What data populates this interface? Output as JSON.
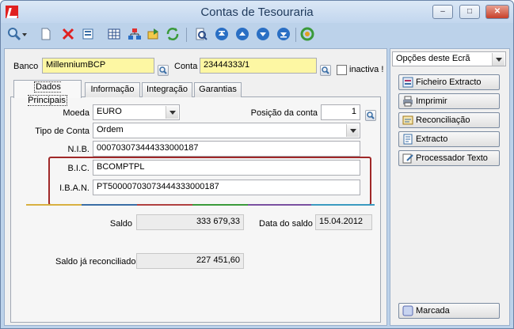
{
  "window": {
    "title": "Contas de Tesouraria",
    "controls": {
      "minimize": "–",
      "maximize": "□",
      "close": "✕"
    }
  },
  "toolbar": {
    "icons": [
      "search-icon",
      "new-document-icon",
      "delete-icon",
      "properties-icon",
      "grid-icon",
      "hierarchy-icon",
      "export-icon",
      "refresh-icon",
      "print-preview-icon",
      "first-record-icon",
      "previous-record-icon",
      "next-record-icon",
      "last-record-icon",
      "help-refresh-icon"
    ]
  },
  "header": {
    "banco_label": "Banco",
    "banco_value": "MillenniumBCP",
    "conta_label": "Conta",
    "conta_value": "23444333/1",
    "inactiva_label": "inactiva !"
  },
  "tabs": [
    {
      "label": "Dados Principais"
    },
    {
      "label": "Informação"
    },
    {
      "label": "Integração"
    },
    {
      "label": "Garantias"
    }
  ],
  "form": {
    "moeda_label": "Moeda",
    "moeda_value": "EURO",
    "posicao_label": "Posição da conta",
    "posicao_value": "1",
    "tipo_label": "Tipo de Conta",
    "tipo_value": "Ordem",
    "nib_label": "N.I.B.",
    "nib_value": "000703073444333000187",
    "bic_label": "B.I.C.",
    "bic_value": "BCOMPTPL",
    "iban_label": "I.B.A.N.",
    "iban_value": "PT50000703073444333000187",
    "saldo_label": "Saldo",
    "saldo_value": "333 679,33",
    "data_saldo_label": "Data do saldo",
    "data_saldo_value": "15.04.2012",
    "reconciliado_label": "Saldo já reconciliado",
    "reconciliado_value": "227 451,60"
  },
  "right_panel": {
    "dropdown_value": "Opções deste Ecrã",
    "buttons": [
      {
        "label": "Ficheiro Extracto",
        "icon": "file-extract-icon"
      },
      {
        "label": "Imprimir",
        "icon": "printer-icon"
      },
      {
        "label": "Reconciliação",
        "icon": "reconcile-icon"
      },
      {
        "label": "Extracto",
        "icon": "extract-icon"
      },
      {
        "label": "Processador Texto",
        "icon": "text-processor-icon"
      }
    ],
    "marcada_label": "Marcada"
  },
  "colors": {
    "highlight_border": "#a02828",
    "yellow_field": "#fdf7a3",
    "titlebar": "#c2d6ee",
    "nav_blue": "#2a6fc4"
  }
}
